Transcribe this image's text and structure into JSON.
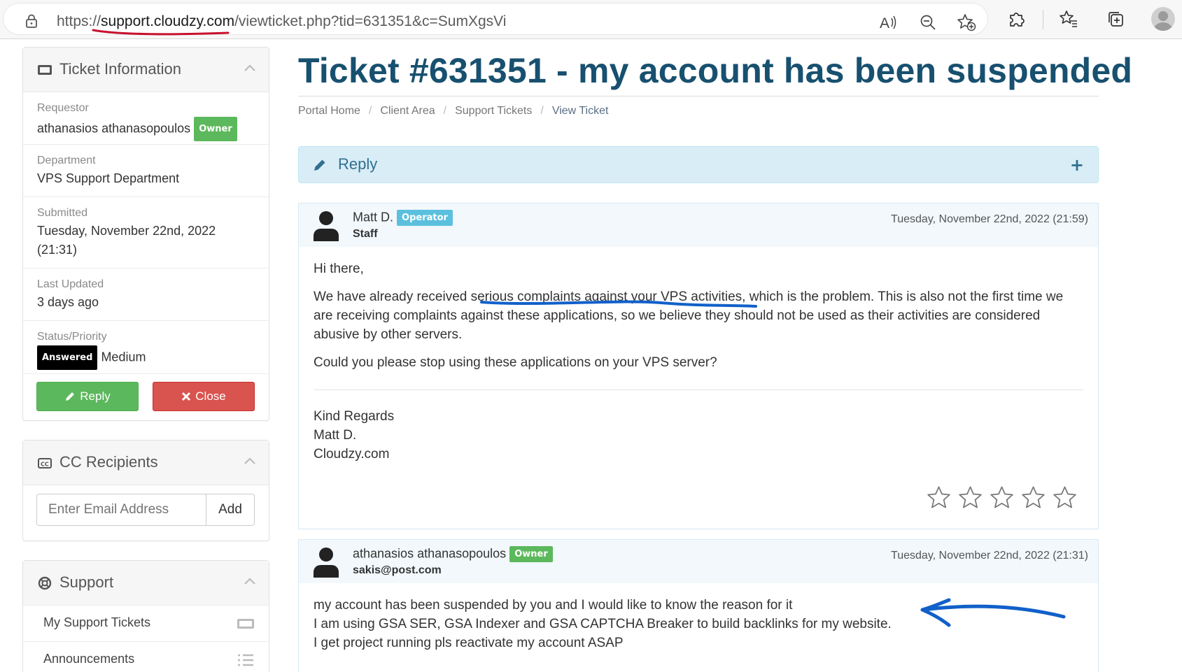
{
  "browser": {
    "url_prefix": "https://",
    "url_domain": "support.cloudzy.com",
    "url_path": "/viewticket.php?tid=631351&c=SumXgsVi",
    "icons": [
      "lock-icon",
      "read-aloud-icon",
      "zoom-out-icon",
      "favorite-add-icon",
      "extensions-icon",
      "favorites-icon",
      "collections-icon",
      "profile-avatar-icon"
    ]
  },
  "sidebar": {
    "ticket_info": {
      "title": "Ticket Information",
      "requestor_label": "Requestor",
      "requestor_value": "athanasios athanasopoulos",
      "requestor_badge": "Owner",
      "department_label": "Department",
      "department_value": "VPS Support Department",
      "submitted_label": "Submitted",
      "submitted_value": "Tuesday, November 22nd, 2022 (21:31)",
      "updated_label": "Last Updated",
      "updated_value": "3 days ago",
      "status_label": "Status/Priority",
      "status_badge": "Answered",
      "priority_value": "Medium",
      "reply_button": "Reply",
      "close_button": "Close"
    },
    "cc": {
      "title": "CC Recipients",
      "input_placeholder": "Enter Email Address",
      "add_button": "Add"
    },
    "support": {
      "title": "Support",
      "items": [
        {
          "label": "My Support Tickets",
          "icon": "ticket-icon"
        },
        {
          "label": "Announcements",
          "icon": "list-icon"
        }
      ]
    }
  },
  "main": {
    "title": "Ticket #631351 - my account has been suspended",
    "breadcrumb": [
      "Portal Home",
      "Client Area",
      "Support Tickets",
      "View Ticket"
    ],
    "reply_bar": {
      "label": "Reply",
      "expand": "+"
    },
    "messages": [
      {
        "name": "Matt D.",
        "badge": "Operator",
        "role": "Staff",
        "date": "Tuesday, November 22nd, 2022 (21:59)",
        "greeting": "Hi there,",
        "p1": "We have already received serious complaints against your VPS activities, which is the problem. This is also not the first time we are receiving complaints against these applications, so we believe they should not be used as their activities are considered abusive by other servers.",
        "p2": "Could you please stop using these applications on your VPS server?",
        "sig1": "Kind Regards",
        "sig2": "Matt D.",
        "sig3": "Cloudzy.com",
        "rating_max": 5,
        "rating_value": 0
      },
      {
        "name": "athanasios athanasopoulos",
        "badge": "Owner",
        "role": "sakis@post.com",
        "date": "Tuesday, November 22nd, 2022 (21:31)",
        "l1": "my account has been suspended by you and I would like to know the reason for it",
        "l2": "I am using GSA SER, GSA Indexer and GSA CAPTCHA Breaker to build backlinks for my website.",
        "l3": "I get project running pls reactivate my account ASAP"
      }
    ]
  },
  "colors": {
    "title": "#18506f",
    "annotation_red": "#c8102e",
    "annotation_blue": "#1160c9",
    "green": "#5cb85c",
    "red": "#d9534f",
    "info_bg": "#d9edf7"
  }
}
